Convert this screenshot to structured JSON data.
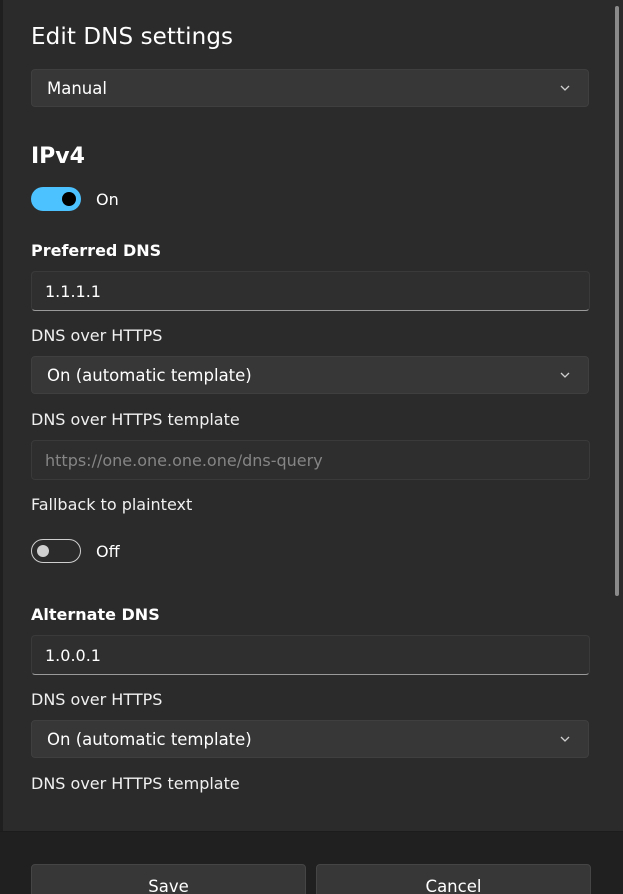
{
  "dialog": {
    "title": "Edit DNS settings",
    "mode_select": {
      "value": "Manual"
    }
  },
  "ipv4": {
    "heading": "IPv4",
    "toggle": {
      "state": "On",
      "checked": true
    },
    "preferred": {
      "label": "Preferred DNS",
      "value": "1.1.1.1",
      "doh_label": "DNS over HTTPS",
      "doh_value": "On (automatic template)",
      "template_label": "DNS over HTTPS template",
      "template_placeholder": "https://one.one.one.one/dns-query",
      "fallback_label": "Fallback to plaintext",
      "fallback_state": "Off",
      "fallback_checked": false
    },
    "alternate": {
      "label": "Alternate DNS",
      "value": "1.0.0.1",
      "doh_label": "DNS over HTTPS",
      "doh_value": "On (automatic template)",
      "template_label": "DNS over HTTPS template"
    }
  },
  "footer": {
    "save_label": "Save",
    "cancel_label": "Cancel"
  },
  "colors": {
    "accent": "#4cc2ff",
    "background": "#2b2b2b",
    "footer_background": "#202020"
  },
  "icons": {
    "dropdown": "chevron-down-icon"
  }
}
